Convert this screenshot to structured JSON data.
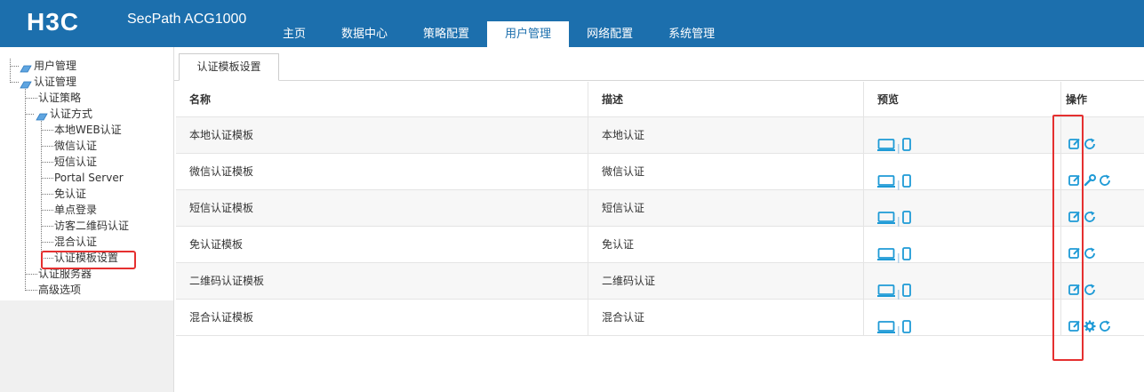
{
  "header": {
    "logo": "H3C",
    "product": "SecPath ACG1000",
    "nav": [
      "主页",
      "数据中心",
      "策略配置",
      "用户管理",
      "网络配置",
      "系统管理"
    ],
    "active_nav": "用户管理",
    "bg_color": "#1c6fad"
  },
  "sidebar": {
    "tree": {
      "user_mgmt": "用户管理",
      "auth_mgmt": "认证管理",
      "auth_policy": "认证策略",
      "auth_method": "认证方式",
      "local_web": "本地WEB认证",
      "wechat": "微信认证",
      "sms": "短信认证",
      "portal": "Portal Server",
      "no_auth": "免认证",
      "sso": "单点登录",
      "visitor_qr": "访客二维码认证",
      "mixed": "混合认证",
      "template": "认证模板设置",
      "auth_server": "认证服务器",
      "advanced": "高级选项"
    },
    "selected": "认证模板设置"
  },
  "main": {
    "tab_label": "认证模板设置",
    "columns": [
      "名称",
      "描述",
      "预览",
      "操作"
    ],
    "rows": [
      {
        "name": "本地认证模板",
        "desc": "本地认证",
        "actions": [
          "edit-icon",
          "refresh-icon"
        ]
      },
      {
        "name": "微信认证模板",
        "desc": "微信认证",
        "actions": [
          "edit-icon",
          "wrench-icon",
          "refresh-icon"
        ]
      },
      {
        "name": "短信认证模板",
        "desc": "短信认证",
        "actions": [
          "edit-icon",
          "refresh-icon"
        ]
      },
      {
        "name": "免认证模板",
        "desc": "免认证",
        "actions": [
          "edit-icon",
          "refresh-icon"
        ]
      },
      {
        "name": "二维码认证模板",
        "desc": "二维码认证",
        "actions": [
          "edit-icon",
          "refresh-icon"
        ]
      },
      {
        "name": "混合认证模板",
        "desc": "混合认证",
        "actions": [
          "edit-icon",
          "gear-icon",
          "refresh-icon"
        ]
      }
    ],
    "preview_icons": [
      "desktop-icon",
      "mobile-icon"
    ],
    "icon_color": "#1e9ad6",
    "highlight_color": "#e53030"
  }
}
